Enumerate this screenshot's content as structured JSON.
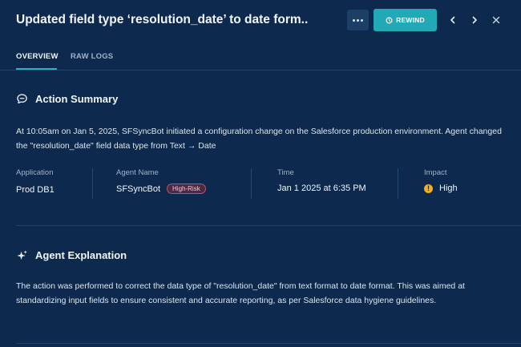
{
  "header": {
    "title": "Updated field type ‘resolution_date’ to date form..",
    "rewind_label": "REWIND"
  },
  "tabs": [
    {
      "label": "OVERVIEW",
      "active": true
    },
    {
      "label": "RAW LOGS",
      "active": false
    }
  ],
  "action_summary": {
    "heading": "Action Summary",
    "text": "At 10:05am on Jan 5, 2025, SFSyncBot initiated a configuration change on the Salesforce production environment. Agent changed the \"resolution_date\" field data type from Text → Date",
    "fields": {
      "application": {
        "label": "Application",
        "value": "Prod DB1"
      },
      "agent": {
        "label": "Agent Name",
        "value": "SFSyncBot",
        "badge": "High-Risk"
      },
      "time": {
        "label": "Time",
        "value": "Jan 1 2025 at 6:35 PM"
      },
      "impact": {
        "label": "Impact",
        "value": "High",
        "icon_glyph": "!"
      }
    }
  },
  "agent_explanation": {
    "heading": "Agent Explanation",
    "text": "The action was performed to correct the data type of \"resolution_date\" from text format to date format. This was aimed at standardizing input fields to ensure consistent and accurate reporting, as per Salesforce data hygiene guidelines."
  },
  "colors": {
    "background": "#0d2a4e",
    "accent": "#22a9b6",
    "badge_border": "#c0506c",
    "impact_high": "#f2b01e"
  },
  "icons": {
    "more": "more-icon",
    "rewind": "clock-rewind-icon",
    "prev": "chevron-left-icon",
    "next": "chevron-right-icon",
    "close": "close-icon",
    "summary": "chat-bubble-icon",
    "explanation": "sparkle-icon",
    "impact": "warning-icon"
  }
}
